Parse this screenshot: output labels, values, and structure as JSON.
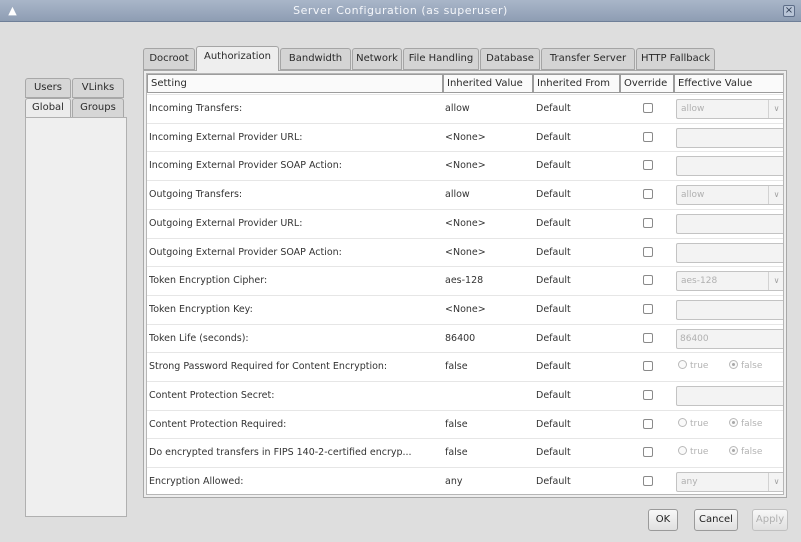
{
  "window": {
    "title": "Server Configuration (as superuser)"
  },
  "left_tabs": {
    "top": [
      "Users",
      "VLinks"
    ],
    "bottom": [
      "Global",
      "Groups"
    ]
  },
  "tabs": [
    "Docroot",
    "Authorization",
    "Bandwidth",
    "Network",
    "File Handling",
    "Database",
    "Transfer Server",
    "HTTP Fallback"
  ],
  "columns": [
    "Setting",
    "Inherited Value",
    "Inherited From",
    "Override",
    "Effective Value"
  ],
  "rows": [
    {
      "setting": "Incoming Transfers:",
      "inherited": "allow",
      "from": "Default",
      "control": "dropdown",
      "value": "allow"
    },
    {
      "setting": "Incoming External Provider URL:",
      "inherited": "<None>",
      "from": "Default",
      "control": "text",
      "value": ""
    },
    {
      "setting": "Incoming External Provider SOAP Action:",
      "inherited": "<None>",
      "from": "Default",
      "control": "text",
      "value": ""
    },
    {
      "setting": "Outgoing Transfers:",
      "inherited": "allow",
      "from": "Default",
      "control": "dropdown",
      "value": "allow"
    },
    {
      "setting": "Outgoing External Provider URL:",
      "inherited": "<None>",
      "from": "Default",
      "control": "text",
      "value": ""
    },
    {
      "setting": "Outgoing External Provider SOAP Action:",
      "inherited": "<None>",
      "from": "Default",
      "control": "text",
      "value": ""
    },
    {
      "setting": "Token Encryption Cipher:",
      "inherited": "aes-128",
      "from": "Default",
      "control": "dropdown",
      "value": "aes-128"
    },
    {
      "setting": "Token Encryption Key:",
      "inherited": "<None>",
      "from": "Default",
      "control": "text",
      "value": ""
    },
    {
      "setting": "Token Life (seconds):",
      "inherited": "86400",
      "from": "Default",
      "control": "text",
      "value": "86400"
    },
    {
      "setting": "Strong Password Required for Content Encryption:",
      "inherited": "false",
      "from": "Default",
      "control": "radio",
      "value": "false"
    },
    {
      "setting": "Content Protection Secret:",
      "inherited": "",
      "from": "Default",
      "control": "text",
      "value": ""
    },
    {
      "setting": "Content Protection Required:",
      "inherited": "false",
      "from": "Default",
      "control": "radio",
      "value": "false"
    },
    {
      "setting": "Do encrypted transfers in FIPS 140-2-certified encryp...",
      "inherited": "false",
      "from": "Default",
      "control": "radio",
      "value": "false"
    },
    {
      "setting": "Encryption Allowed:",
      "inherited": "any",
      "from": "Default",
      "control": "dropdown",
      "value": "any"
    }
  ],
  "radio_labels": {
    "true": "true",
    "false": "false"
  },
  "buttons": {
    "ok": "OK",
    "cancel": "Cancel",
    "apply": "Apply"
  }
}
